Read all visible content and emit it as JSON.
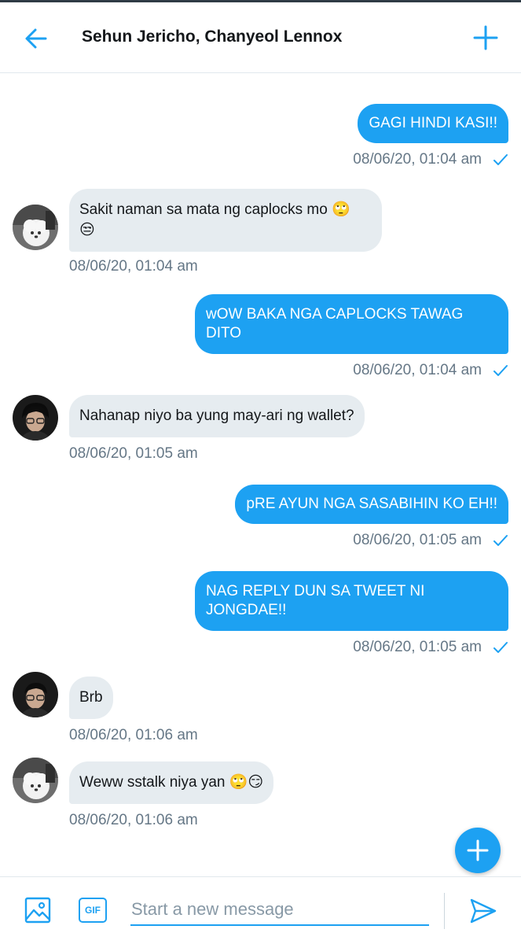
{
  "header": {
    "title": "Sehun Jericho, Chanyeol Lennox",
    "back_icon": "arrow-left-icon",
    "add_icon": "plus-icon"
  },
  "colors": {
    "accent": "#1da1f2",
    "incoming_bubble": "#e6ecf0",
    "meta_text": "#657786"
  },
  "messages": [
    {
      "direction": "outgoing",
      "text": "GAGI HINDI KASI!!",
      "time": "08/06/20, 01:04 am",
      "status_icon": "check-icon"
    },
    {
      "direction": "incoming",
      "sender_avatar": "avatar-dog",
      "text": "Sakit naman sa mata ng caplocks mo 🙄",
      "text2": "😒",
      "time": "08/06/20, 01:04 am"
    },
    {
      "direction": "outgoing",
      "text": "wOW BAKA NGA CAPLOCKS TAWAG",
      "text2": "DITO",
      "time": "08/06/20, 01:04 am",
      "status_icon": "check-icon"
    },
    {
      "direction": "incoming",
      "sender_avatar": "avatar-person",
      "text": "Nahanap niyo ba yung may-ari ng wallet?",
      "time": "08/06/20, 01:05 am"
    },
    {
      "direction": "outgoing",
      "text": "pRE AYUN NGA SASABIHIN KO EH!!",
      "time": "08/06/20, 01:05 am",
      "status_icon": "check-icon"
    },
    {
      "direction": "outgoing",
      "text": "NAG REPLY DUN SA TWEET NI",
      "text2": "JONGDAE!!",
      "time": "08/06/20, 01:05 am",
      "status_icon": "check-icon"
    },
    {
      "direction": "incoming",
      "sender_avatar": "avatar-person",
      "text": "Brb",
      "time": "08/06/20, 01:06 am"
    },
    {
      "direction": "incoming",
      "sender_avatar": "avatar-dog",
      "text": "Weww sstalk niya yan 🙄😏",
      "time": "08/06/20, 01:06 am"
    }
  ],
  "composer": {
    "placeholder": "Start a new message",
    "gif_label": "GIF",
    "media_icon": "image-icon",
    "send_icon": "send-icon"
  },
  "fab_icon": "plus-icon"
}
